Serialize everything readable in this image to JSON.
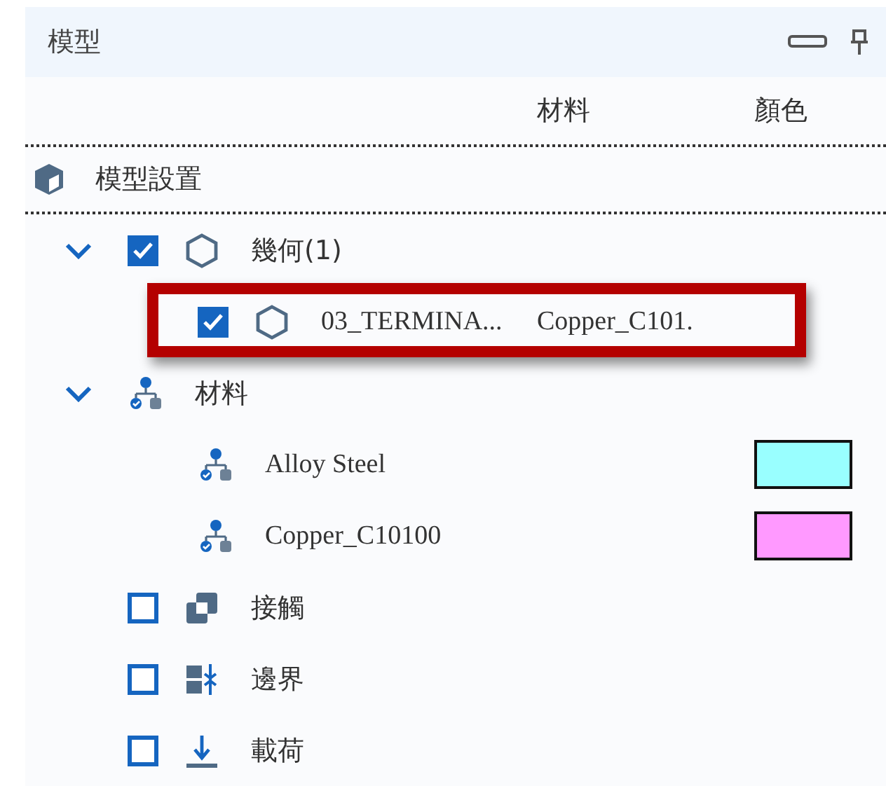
{
  "panel": {
    "title": "模型",
    "columns": [
      "材料",
      "顏色"
    ]
  },
  "settings": {
    "label": "模型設置"
  },
  "tree": [
    {
      "kind": "geometry",
      "label": "幾何(1)",
      "expanded": true,
      "checked": true,
      "children": [
        {
          "kind": "body",
          "label": "03_TERMINA...",
          "material": "Copper_C101.",
          "checked": true,
          "highlighted": true
        }
      ]
    },
    {
      "kind": "materials",
      "label": "材料",
      "expanded": true,
      "children": [
        {
          "kind": "material",
          "label": "Alloy Steel",
          "color": "#99ffff"
        },
        {
          "kind": "material",
          "label": "Copper_C10100",
          "color": "#ff99ff"
        }
      ]
    },
    {
      "kind": "contacts",
      "label": "接觸",
      "checked": false
    },
    {
      "kind": "boundary",
      "label": "邊界",
      "checked": false
    },
    {
      "kind": "load",
      "label": "載荷",
      "checked": false
    }
  ]
}
